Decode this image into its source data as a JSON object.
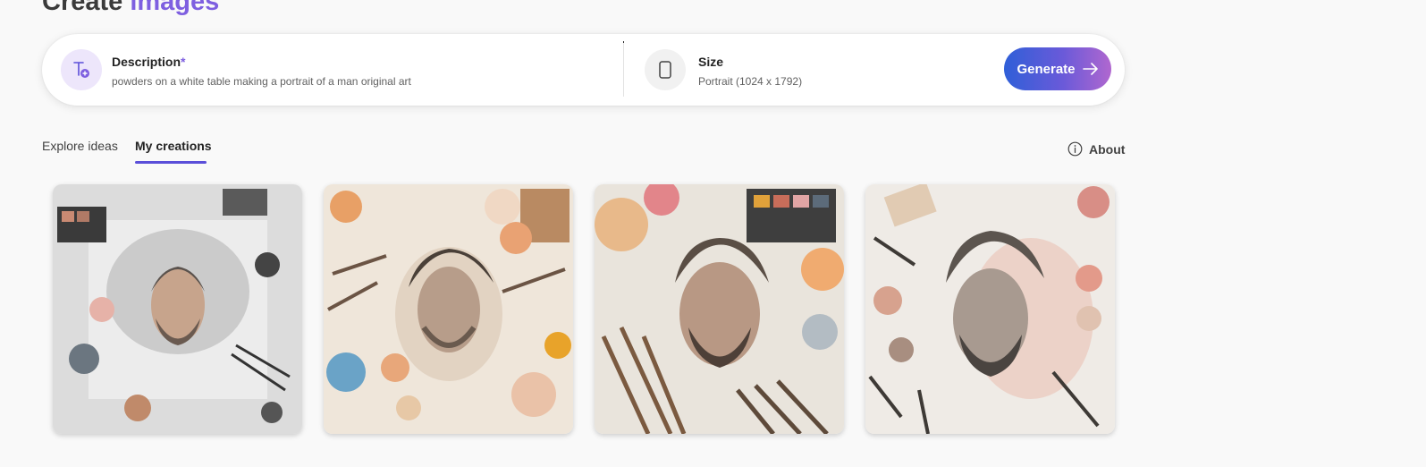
{
  "header": {
    "title_part1": "Create ",
    "title_part2": "images"
  },
  "prompt": {
    "description_label": "Description",
    "required_mark": "*",
    "description_value": "powders on a white table making a portrait of a man original art",
    "size_label": "Size",
    "size_value": "Portrait (1024 x 1792)",
    "generate_label": "Generate"
  },
  "tabs": [
    {
      "label": "Explore ideas"
    },
    {
      "label": "My creations"
    }
  ],
  "about_label": "About",
  "colors": {
    "accent": "#7e5fe0",
    "tab_underline": "#5b4fd9",
    "generate_gradient": [
      "#2f5fd8",
      "#b067cf"
    ]
  },
  "icons": [
    "text-add-icon",
    "portrait-phone-icon",
    "arrow-right-icon",
    "info-icon"
  ],
  "gallery": [
    {
      "alt": "generated-image-1"
    },
    {
      "alt": "generated-image-2"
    },
    {
      "alt": "generated-image-3"
    },
    {
      "alt": "generated-image-4"
    }
  ]
}
